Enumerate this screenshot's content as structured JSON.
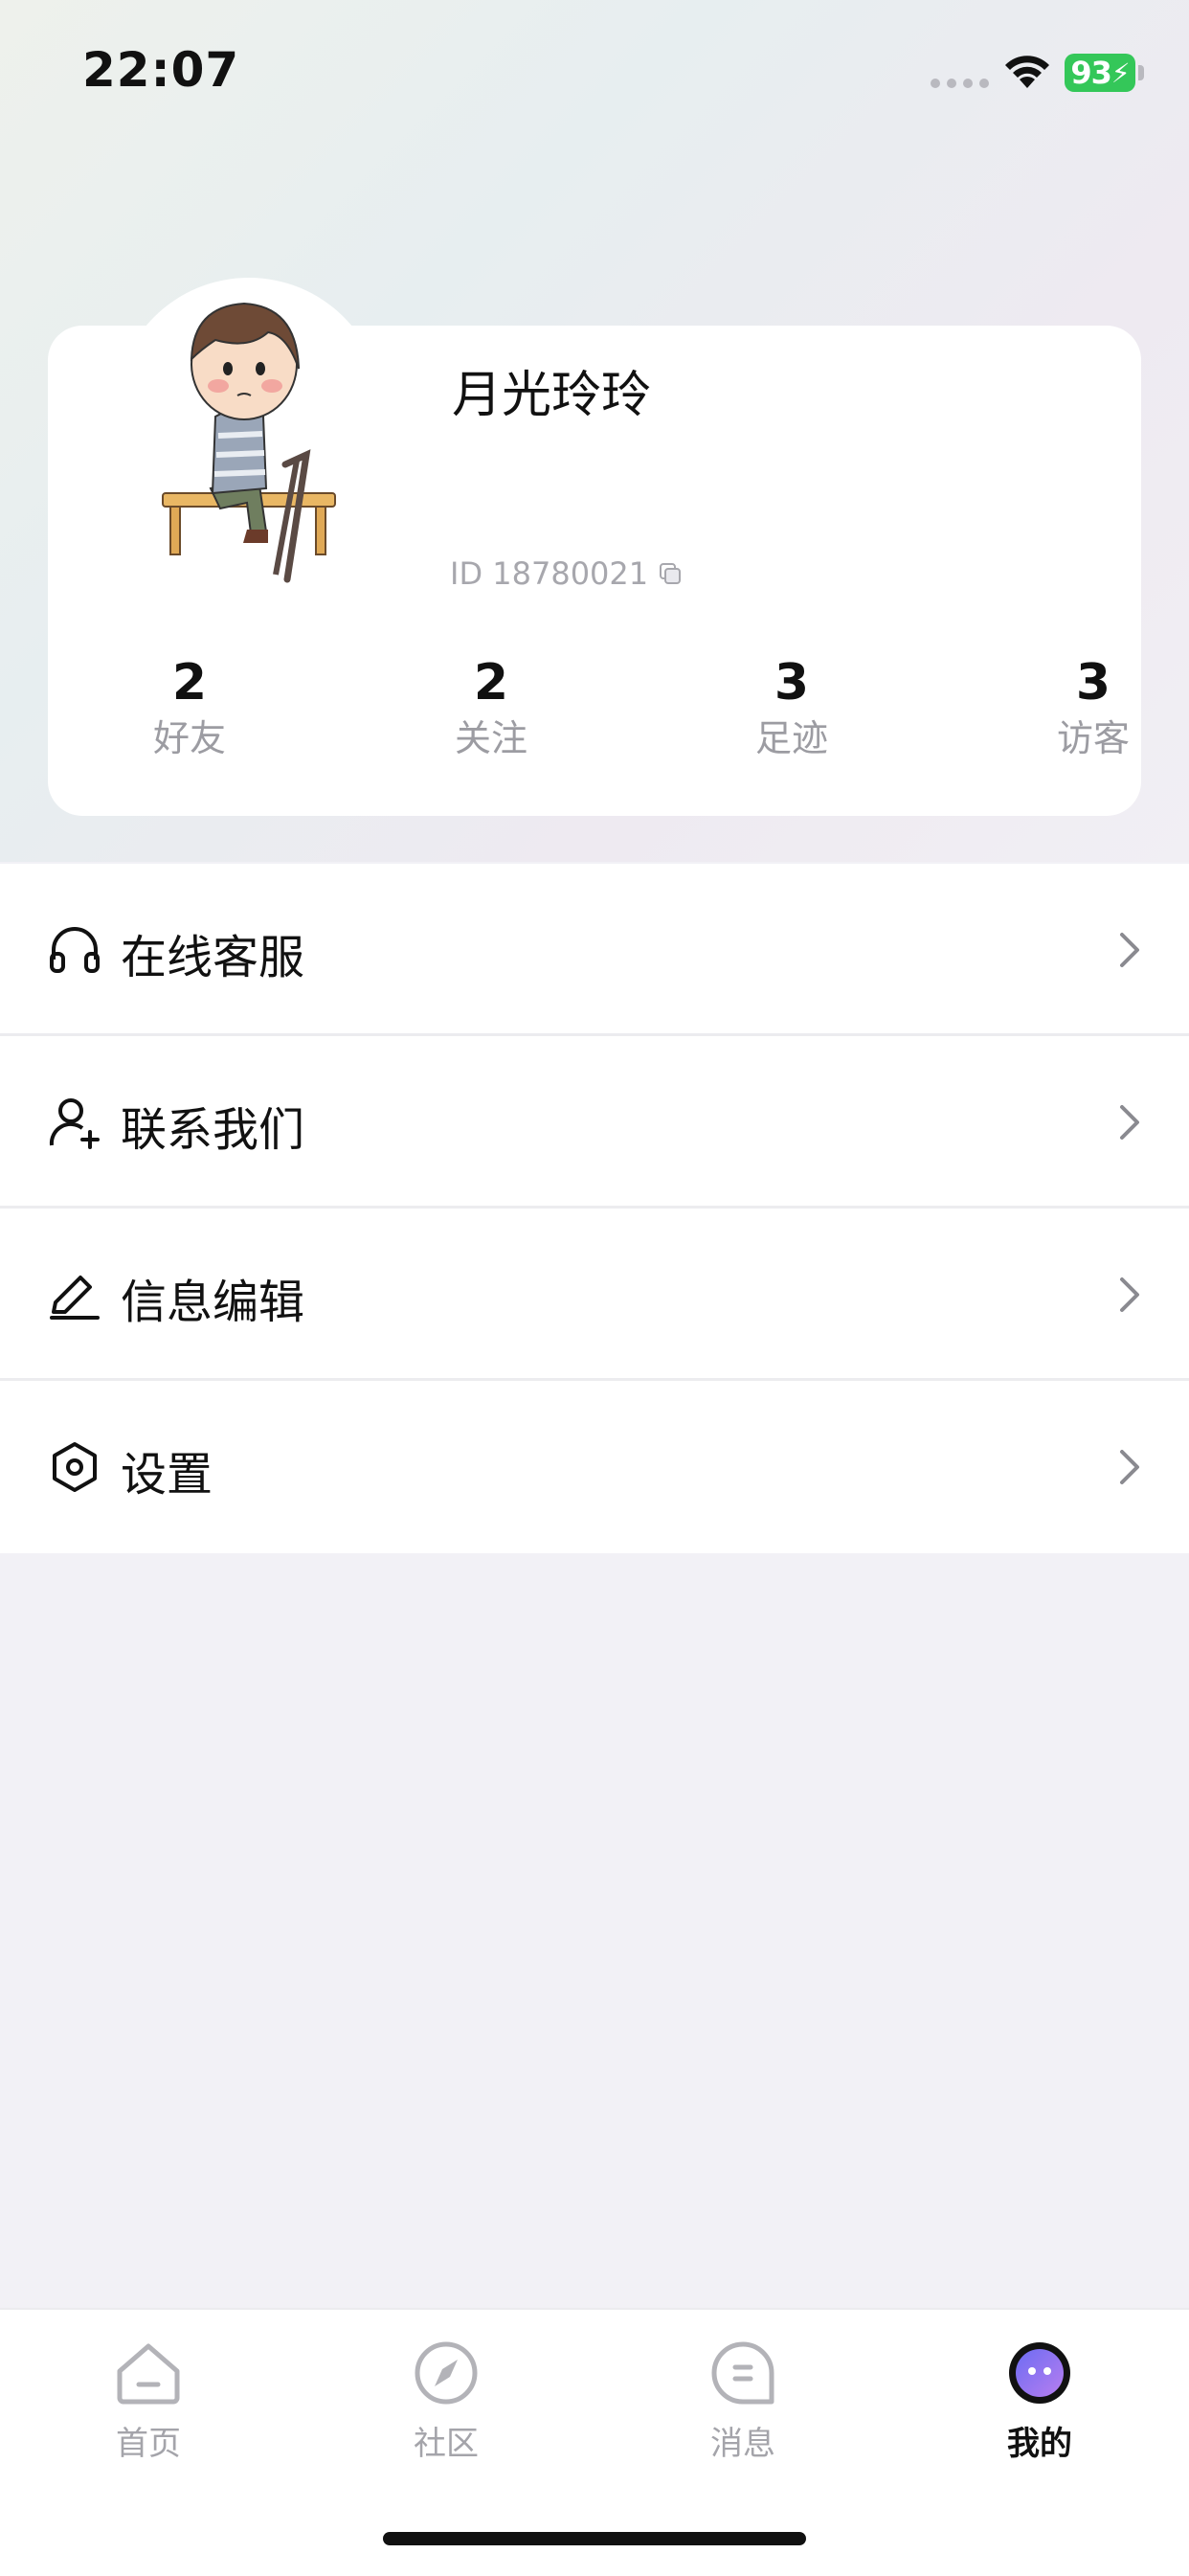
{
  "status_bar": {
    "time": "22:07",
    "battery": "93"
  },
  "profile": {
    "nickname": "月光玲玲",
    "id_text": "ID 18780021",
    "stats": [
      {
        "value": "2",
        "label": "好友"
      },
      {
        "value": "2",
        "label": "关注"
      },
      {
        "value": "3",
        "label": "足迹"
      },
      {
        "value": "3",
        "label": "访客"
      }
    ]
  },
  "menu": [
    {
      "label": "在线客服",
      "icon": "headset-icon"
    },
    {
      "label": "联系我们",
      "icon": "person-add-icon"
    },
    {
      "label": "信息编辑",
      "icon": "pencil-icon"
    },
    {
      "label": "设置",
      "icon": "hexagon-settings-icon"
    }
  ],
  "tabbar": [
    {
      "label": "首页",
      "icon": "home-icon",
      "active": false
    },
    {
      "label": "社区",
      "icon": "compass-icon",
      "active": false
    },
    {
      "label": "消息",
      "icon": "message-icon",
      "active": false
    },
    {
      "label": "我的",
      "icon": "profile-face-icon",
      "active": true
    }
  ],
  "colors": {
    "battery": "#34c759",
    "accent_purple": "#8f73f4",
    "muted_text": "#a4a4aa"
  }
}
